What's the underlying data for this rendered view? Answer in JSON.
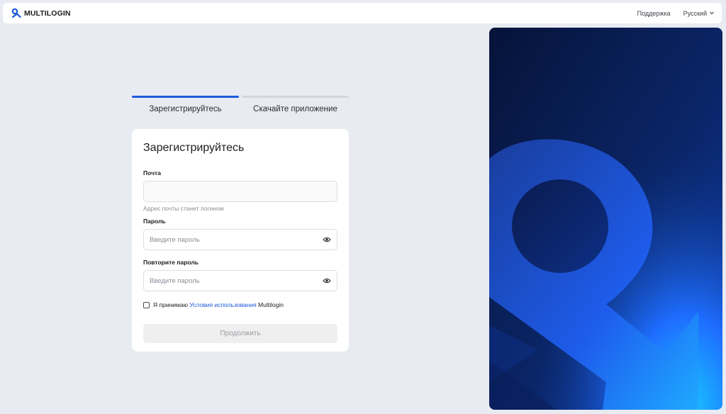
{
  "header": {
    "brand": "MULTILOGIN",
    "brand_icon": "multilogin-logo-icon",
    "support_label": "Поддержка",
    "language_label": "Русский",
    "language_icon": "chevron-down-icon"
  },
  "steps": [
    {
      "label": "Зарегистрируйтесь",
      "active": true
    },
    {
      "label": "Скачайте приложение",
      "active": false
    }
  ],
  "form": {
    "title": "Зарегистрируйтесь",
    "email_label": "Почта",
    "email_value": "",
    "email_hint": "Адрес почты станет логином",
    "password_label": "Пароль",
    "password_placeholder": "Введите пароль",
    "repeat_label": "Повторите пароль",
    "repeat_placeholder": "Введите пароль",
    "eye_icon": "eye-icon",
    "terms_prefix": "Я принимаю ",
    "terms_link": "Условия использования",
    "terms_suffix": " Multilogin",
    "terms_checked": false,
    "submit_label": "Продолжить",
    "submit_enabled": false
  },
  "colors": {
    "accent": "#1a5bdc",
    "background": "#e9ebf2",
    "art_dark": "#081a4a",
    "art_bright": "#1e6dff"
  }
}
